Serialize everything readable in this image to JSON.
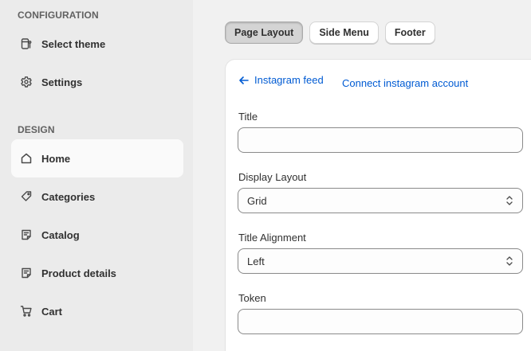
{
  "sidebar": {
    "configuration_title": "CONFIGURATION",
    "configuration_items": [
      {
        "label": "Select theme",
        "icon": "theme-icon"
      },
      {
        "label": "Settings",
        "icon": "gear-icon"
      }
    ],
    "design_title": "DESIGN",
    "design_items": [
      {
        "label": "Home",
        "icon": "home-icon",
        "active": true
      },
      {
        "label": "Categories",
        "icon": "tag-icon"
      },
      {
        "label": "Catalog",
        "icon": "catalog-icon"
      },
      {
        "label": "Product details",
        "icon": "product-details-icon"
      },
      {
        "label": "Cart",
        "icon": "cart-icon"
      }
    ]
  },
  "tabs": [
    {
      "label": "Page Layout",
      "active": true
    },
    {
      "label": "Side Menu"
    },
    {
      "label": "Footer"
    }
  ],
  "panel": {
    "back_label": "Instagram feed",
    "connect_label": "Connect instagram account",
    "fields": {
      "title": {
        "label": "Title",
        "value": ""
      },
      "display_layout": {
        "label": "Display Layout",
        "value": "Grid"
      },
      "title_alignment": {
        "label": "Title Alignment",
        "value": "Left"
      },
      "token": {
        "label": "Token",
        "value": ""
      }
    }
  },
  "colors": {
    "link": "#005bd3",
    "sidebar_bg": "#ebebeb",
    "main_bg": "#f1f1f1"
  }
}
